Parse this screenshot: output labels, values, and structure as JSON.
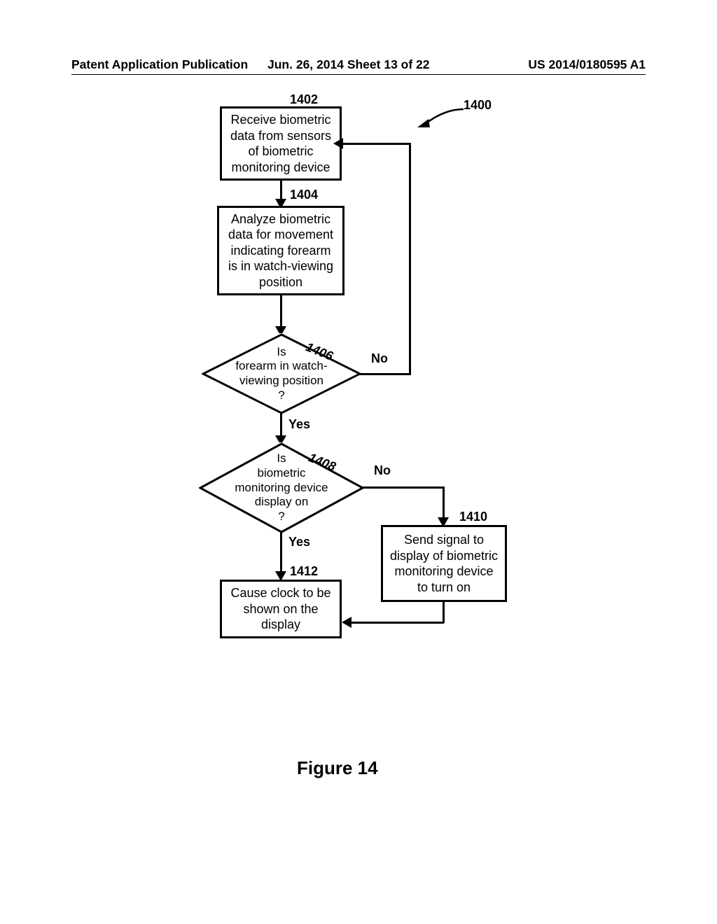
{
  "header": {
    "left": "Patent Application Publication",
    "mid": "Jun. 26, 2014  Sheet 13 of 22",
    "right": "US 2014/0180595 A1"
  },
  "refs": {
    "r1400": "1400",
    "r1402": "1402",
    "r1404": "1404",
    "r1406": "1406",
    "r1408": "1408",
    "r1410": "1410",
    "r1412": "1412"
  },
  "boxes": {
    "b1402": "Receive biometric data from sensors of biometric monitoring device",
    "b1404": "Analyze biometric data for movement indicating forearm is in watch-viewing position",
    "b1410": "Send signal to display of biometric monitoring device to turn on",
    "b1412": "Cause clock to be shown on the display"
  },
  "diamonds": {
    "d1406": "Is\nforearm in watch-\nviewing position\n?",
    "d1408": "Is\nbiometric\nmonitoring device\ndisplay on\n?"
  },
  "labels": {
    "yes": "Yes",
    "no": "No"
  },
  "figure_caption": "Figure 14"
}
